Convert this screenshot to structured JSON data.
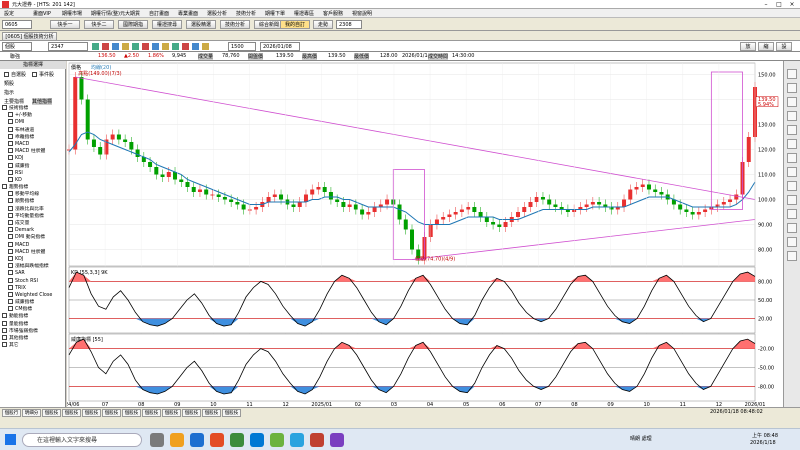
{
  "window": {
    "title": "元大證券 - [HTS: 201 142]"
  },
  "menu": [
    "設定",
    "畫面VIP",
    "期權市場",
    "期權行情(整)",
    "元大期貨",
    "自訂畫面",
    "專業畫面",
    "選股分析",
    "技術分析",
    "期權下單",
    "權證專區",
    "客戶服務",
    "視窗說明"
  ],
  "toolbar": {
    "symbol": "0605",
    "buttons": [
      "快手一",
      "快手二",
      "國際期指",
      "權證搜尋",
      "選股精選",
      "技術分析",
      "綜合新聞"
    ],
    "favorite": "我的自訂",
    "mode": "走勢",
    "code": "2308"
  },
  "main": {
    "title": "[0605] 個股技術分析",
    "controls": {
      "type": "個股",
      "code": "2347",
      "period": "1500",
      "date": "2026/01/08"
    }
  },
  "quote": {
    "name": "聯強",
    "open": "136.50",
    "change": "▲2.50",
    "pct": "1.86%",
    "high": "9,945",
    "vol_label": "成交量",
    "vol": "78,760",
    "prev_label": "開盤價",
    "prev": "139.50",
    "hi_label": "最高價",
    "hi": "139.50",
    "lo_label": "最低價",
    "lo": "128.00",
    "date": "2026/01/14",
    "time_label": "成交時間",
    "time": "14:30:00"
  },
  "left_panel": {
    "header": "指標選擇",
    "options": [
      "自選股",
      "事件股"
    ],
    "label1": "類股",
    "label2": "指示",
    "tabs": [
      "主要指標",
      "其他指標"
    ],
    "tree": [
      "技術指標",
      "+/-移動",
      "DMI",
      "布林通道",
      "乖離指標",
      "MACD",
      "MACD 柱狀體",
      "KDJ",
      "威廉指",
      "RSI",
      "KD",
      "趨勢指標",
      "移動平均線",
      "順勢指標",
      "漲跌比與比率",
      "平均動量指標",
      "成交量",
      "Demark",
      "DMI 動向指標",
      "MACD",
      "MACD 柱狀體",
      "KDJ",
      "漲幅與跌幅指標",
      "SAR",
      "Stoch RSI",
      "TRIX",
      "Weighted Close",
      "威廉指標",
      "CM指標",
      "動能指標",
      "量能指標",
      "市場強弱指標",
      "其他指標",
      "其它"
    ]
  },
  "chart_data": [
    {
      "type": "line",
      "title": "價格",
      "legend": "均線(20)",
      "annotations": [
        "高點(149.00)(7/3)",
        "低點(74.70)(4/9)"
      ],
      "x_ticks": [
        "2024/06",
        "07",
        "08",
        "09",
        "10",
        "11",
        "12",
        "2025/01",
        "02",
        "03",
        "04",
        "05",
        "06",
        "07",
        "08",
        "09",
        "10",
        "11",
        "12",
        "2026/01"
      ],
      "y_ticks": [
        150,
        140,
        130,
        120,
        110,
        100,
        90,
        80
      ],
      "ylim": [
        75,
        153
      ],
      "last_price": "139.50",
      "last_label": "5.94%",
      "close": [
        120,
        149,
        140,
        124,
        121,
        118,
        124,
        126,
        124,
        123,
        120,
        117,
        115,
        113,
        110,
        109,
        111,
        108,
        107,
        105,
        103,
        104,
        102,
        102,
        101,
        100,
        99,
        98,
        96,
        96,
        97,
        99,
        101,
        102,
        100,
        98,
        97,
        99,
        102,
        104,
        105,
        103,
        100,
        99,
        97,
        98,
        96,
        94,
        95,
        97,
        98,
        100,
        98,
        92,
        88,
        80,
        76,
        85,
        90,
        92,
        93,
        94,
        95,
        96,
        97,
        95,
        93,
        91,
        90,
        89,
        91,
        93,
        95,
        97,
        99,
        101,
        100,
        98,
        97,
        96,
        95,
        96,
        97,
        98,
        99,
        98,
        97,
        96,
        97,
        100,
        104,
        105,
        106,
        104,
        103,
        102,
        100,
        98,
        96,
        95,
        94,
        95,
        96,
        97,
        98,
        99,
        100,
        102,
        115,
        125,
        145
      ],
      "ma": [
        119,
        122,
        126,
        127,
        126,
        124,
        123,
        122,
        121,
        120,
        119,
        118,
        117,
        116,
        114,
        113,
        112,
        111,
        110,
        108,
        107,
        106,
        105,
        104,
        103,
        102,
        101,
        100,
        99,
        98,
        98,
        98,
        99,
        99,
        99,
        99,
        99,
        99,
        99,
        100,
        100,
        101,
        101,
        101,
        100,
        100,
        99,
        98,
        97,
        97,
        97,
        97,
        97,
        96,
        95,
        93,
        91,
        90,
        90,
        90,
        90,
        90,
        91,
        92,
        93,
        93,
        93,
        93,
        93,
        92,
        92,
        92,
        92,
        93,
        94,
        95,
        96,
        96,
        96,
        96,
        96,
        96,
        96,
        96,
        97,
        97,
        97,
        97,
        97,
        97,
        98,
        99,
        100,
        101,
        101,
        101,
        101,
        100,
        99,
        98,
        97,
        97,
        97,
        97,
        97,
        97,
        97,
        98,
        100,
        103,
        107
      ]
    },
    {
      "type": "line",
      "title": "KD [55,3,3] 9K",
      "y_ticks": [
        80,
        50,
        20
      ],
      "ylim": [
        0,
        100
      ],
      "levels": [
        80,
        50,
        20
      ],
      "k": [
        70,
        95,
        90,
        60,
        40,
        35,
        55,
        65,
        50,
        30,
        15,
        10,
        8,
        12,
        20,
        35,
        50,
        60,
        45,
        25,
        12,
        8,
        10,
        30,
        55,
        70,
        80,
        75,
        60,
        40,
        25,
        12,
        8,
        15,
        35,
        60,
        80,
        90,
        85,
        70,
        50,
        30,
        15,
        10,
        20,
        40,
        65,
        85,
        90,
        75,
        55,
        35,
        20,
        12,
        10,
        25,
        50,
        70,
        85,
        80,
        65,
        45,
        30,
        20,
        15,
        20,
        35,
        55,
        75,
        88,
        90,
        80,
        60,
        40,
        25,
        15,
        12,
        20,
        40,
        65,
        85,
        90,
        80,
        60,
        40,
        25,
        15,
        20,
        40,
        60,
        80,
        92,
        95,
        88
      ]
    },
    {
      "type": "line",
      "title": "威廉指標 [55]",
      "y_ticks": [
        -20,
        -50,
        -80
      ],
      "ylim": [
        -100,
        0
      ],
      "levels": [
        -20,
        -50,
        -80
      ],
      "w": [
        -30,
        -10,
        -5,
        -25,
        -50,
        -60,
        -40,
        -30,
        -45,
        -70,
        -85,
        -90,
        -92,
        -88,
        -80,
        -65,
        -50,
        -40,
        -55,
        -75,
        -88,
        -92,
        -90,
        -70,
        -45,
        -30,
        -20,
        -25,
        -40,
        -60,
        -75,
        -88,
        -92,
        -85,
        -65,
        -40,
        -20,
        -10,
        -15,
        -30,
        -50,
        -70,
        -85,
        -90,
        -80,
        -60,
        -35,
        -15,
        -10,
        -25,
        -45,
        -65,
        -80,
        -88,
        -90,
        -75,
        -50,
        -30,
        -15,
        -20,
        -35,
        -55,
        -70,
        -80,
        -85,
        -80,
        -65,
        -45,
        -25,
        -12,
        -10,
        -20,
        -40,
        -60,
        -75,
        -85,
        -88,
        -80,
        -60,
        -35,
        -15,
        -10,
        -20,
        -40,
        -60,
        -75,
        -85,
        -80,
        -60,
        -40,
        -20,
        -8,
        -5,
        -12
      ]
    }
  ],
  "status_tabs": [
    "個股行情",
    "明細分析",
    "個股技術",
    "個股技術",
    "個股技術",
    "個股技術",
    "個股技術",
    "個股技術",
    "個股技術",
    "個股技術",
    "個股技術",
    "個股技術"
  ],
  "status_time": "2026/01/18 08:48:02",
  "taskbar": {
    "search_placeholder": "在這裡輸入文字來搜尋",
    "tray_text": "晴朗 處理",
    "clock_time": "上午 08:48",
    "clock_date": "2026/1/18"
  },
  "colors": {
    "accent": "#c00000",
    "ma_line": "#1f77b4",
    "up": "#e83030",
    "down": "#00a000",
    "bull_fill": "#ff7070",
    "bear_fill": "#3f8fdf"
  }
}
